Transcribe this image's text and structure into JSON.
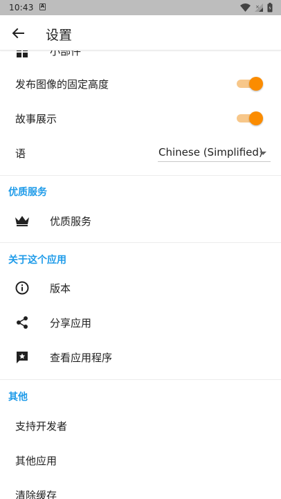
{
  "status_bar": {
    "time": "10:43",
    "notification_letter": "A"
  },
  "app_bar": {
    "title": "设置"
  },
  "settings": {
    "widget_label": "小部件",
    "fixed_height_label": "发布图像的固定高度",
    "fixed_height_enabled": true,
    "story_label": "故事展示",
    "story_enabled": true,
    "language_label": "语",
    "language_value": "Chinese (Simplified)"
  },
  "premium": {
    "header": "优质服务",
    "item_label": "优质服务"
  },
  "about": {
    "header": "关于这个应用",
    "version_label": "版本",
    "share_label": "分享应用",
    "review_label": "查看应用程序"
  },
  "other": {
    "header": "其他",
    "support_label": "支持开发者",
    "more_apps_label": "其他应用",
    "clear_cache_label": "清除缓存"
  },
  "colors": {
    "accent": "#1e9be9",
    "switch_thumb": "#fb8c00",
    "switch_track": "#f7c78a",
    "status_bar": "#bdbdbd",
    "widget_badge": "#ffe14a"
  },
  "icons": {
    "back": "arrow-left-icon",
    "widget": "grid-icon",
    "premium": "crown-icon",
    "version": "info-icon",
    "share": "share-icon",
    "review": "feedback-icon",
    "wifi": "wifi-icon",
    "signal": "signal-icon",
    "battery": "battery-icon"
  }
}
